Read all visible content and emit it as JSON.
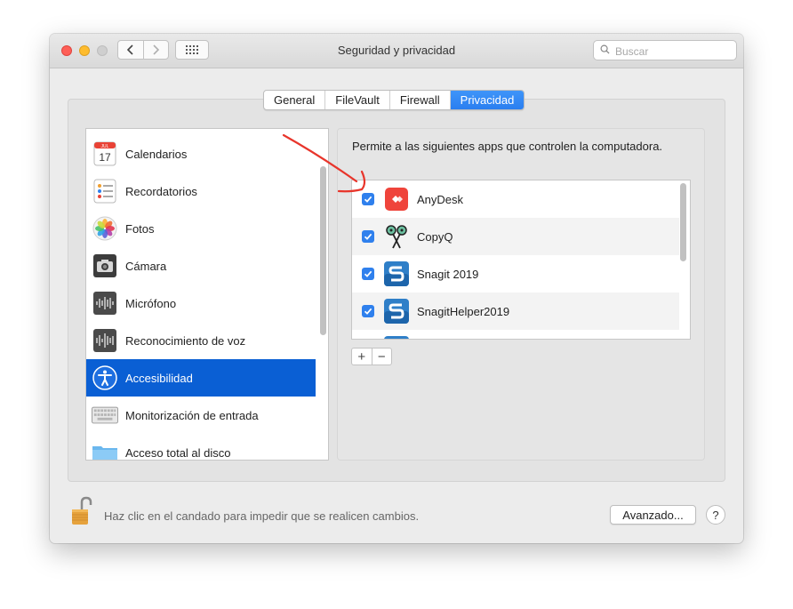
{
  "window": {
    "title": "Seguridad y privacidad",
    "search_placeholder": "Buscar"
  },
  "tabs": [
    {
      "label": "General",
      "active": false
    },
    {
      "label": "FileVault",
      "active": false
    },
    {
      "label": "Firewall",
      "active": false
    },
    {
      "label": "Privacidad",
      "active": true
    }
  ],
  "sidebar": {
    "items": [
      {
        "label": "Calendarios",
        "icon": "calendar-icon",
        "icon_text": "17",
        "icon_header": "JUL",
        "selected": false
      },
      {
        "label": "Recordatorios",
        "icon": "reminders-icon",
        "selected": false
      },
      {
        "label": "Fotos",
        "icon": "photos-icon",
        "selected": false
      },
      {
        "label": "Cámara",
        "icon": "camera-icon",
        "selected": false
      },
      {
        "label": "Micrófono",
        "icon": "microphone-icon",
        "selected": false
      },
      {
        "label": "Reconocimiento de voz",
        "icon": "speech-recognition-icon",
        "selected": false
      },
      {
        "label": "Accesibilidad",
        "icon": "accessibility-icon",
        "selected": true
      },
      {
        "label": "Monitorización de entrada",
        "icon": "keyboard-icon",
        "selected": false
      },
      {
        "label": "Acceso total al disco",
        "icon": "folder-icon",
        "selected": false
      }
    ]
  },
  "main": {
    "description": "Permite a las siguientes apps que controlen la computadora.",
    "apps": [
      {
        "name": "AnyDesk",
        "checked": true,
        "icon": "anydesk-icon"
      },
      {
        "name": "CopyQ",
        "checked": true,
        "icon": "copyq-icon"
      },
      {
        "name": "Snagit 2019",
        "checked": true,
        "icon": "snagit-icon"
      },
      {
        "name": "SnagitHelper2019",
        "checked": true,
        "icon": "snagit-icon"
      }
    ],
    "add_symbol": "+",
    "remove_symbol": "−"
  },
  "footer": {
    "lock_text": "Haz clic en el candado para impedir que se realicen cambios.",
    "advanced_label": "Avanzado...",
    "help_label": "?"
  },
  "colors": {
    "accent": "#2a7ef0",
    "selection": "#0a5fd4",
    "annotation_arrow": "#e8352b"
  }
}
